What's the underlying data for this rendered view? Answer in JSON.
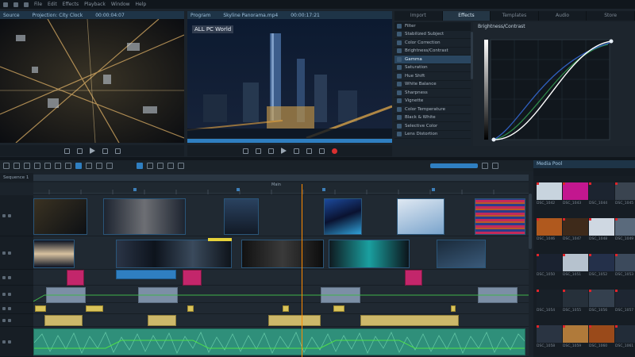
{
  "menubar": {
    "items": [
      "File",
      "Edit",
      "Effects",
      "Playback",
      "Window",
      "Help"
    ]
  },
  "source_monitor": {
    "title": "Source",
    "clip_name": "Projection: City Clock",
    "timecode": "00:00:04:07"
  },
  "program_monitor": {
    "title": "Program",
    "clip_name": "Skyline Panorama.mp4",
    "timecode": "00:00:17:21",
    "watermark": "ALL PC World"
  },
  "effects": {
    "tabs": [
      "Import",
      "Effects",
      "Templates",
      "Audio",
      "Store"
    ],
    "active_tab": "Effects",
    "search_label": "Filter",
    "items": [
      "Stabilized Subject",
      "Color Correction",
      "Brightness/Contrast",
      "Gamma",
      "Saturation",
      "Hue Shift",
      "White Balance",
      "Sharpness",
      "Vignette",
      "Color Temperature",
      "Black & White",
      "Selective Color",
      "Lens Distortion"
    ],
    "selected_index": 3,
    "curve_title": "Brightness/Contrast"
  },
  "timeline": {
    "sequence_name": "Sequence 1",
    "marker_label": "Main",
    "track_count": 9
  },
  "media_pool": {
    "title": "Media Pool",
    "items": [
      {
        "label": "DSC_1042",
        "color": "#c8d4de"
      },
      {
        "label": "DSC_1043",
        "color": "#c3178f"
      },
      {
        "label": "DSC_1044",
        "color": "#1c2430"
      },
      {
        "label": "DSC_1045",
        "color": "#3a4450"
      },
      {
        "label": "DSC_1046",
        "color": "#b0591e"
      },
      {
        "label": "DSC_1047",
        "color": "#3e2a1a"
      },
      {
        "label": "DSC_1048",
        "color": "#cfd8e2"
      },
      {
        "label": "DSC_1049",
        "color": "#5a6a7c"
      },
      {
        "label": "DSC_1050",
        "color": "#1a2230"
      },
      {
        "label": "DSC_1051",
        "color": "#b6c2ce"
      },
      {
        "label": "DSC_1052",
        "color": "#24304a"
      },
      {
        "label": "DSC_1053",
        "color": "#3c4a5c"
      },
      {
        "label": "DSC_1054",
        "color": "#182028"
      },
      {
        "label": "DSC_1055",
        "color": "#26303a"
      },
      {
        "label": "DSC_1056",
        "color": "#34404e"
      },
      {
        "label": "DSC_1057",
        "color": "#1e2632"
      },
      {
        "label": "DSC_1058",
        "color": "#2a3442"
      },
      {
        "label": "DSC_1059",
        "color": "#b07a3a"
      },
      {
        "label": "DSC_1060",
        "color": "#9a4a1a"
      },
      {
        "label": "DSC_1061",
        "color": "#222c38"
      }
    ]
  },
  "colors": {
    "accent": "#2f7fc1",
    "playhead": "#ff8a00",
    "audio_clip": "#d9c35a",
    "audio_wave": "#3fb38a",
    "magenta_clip": "#c3266b"
  }
}
